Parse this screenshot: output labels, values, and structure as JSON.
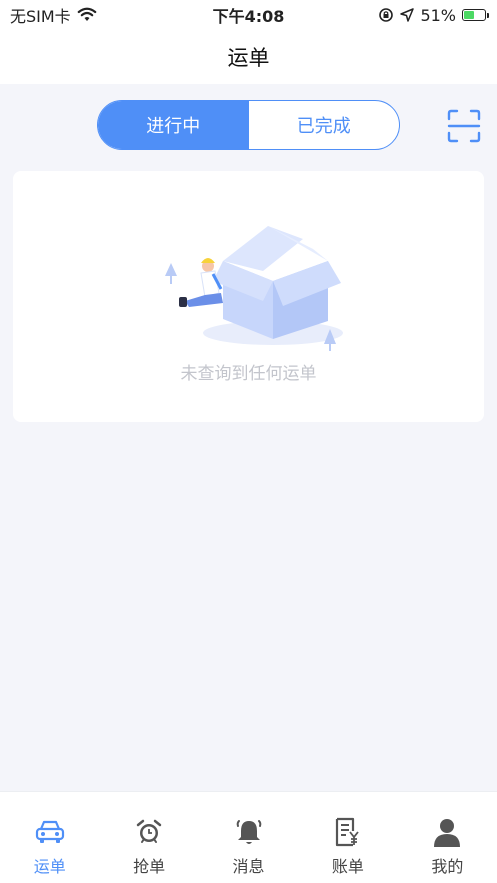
{
  "status_bar": {
    "carrier": "无SIM卡",
    "time": "下午4:08",
    "battery": "51%",
    "battery_level": 0.51
  },
  "nav": {
    "title": "运单"
  },
  "segment": {
    "tabs": [
      {
        "label": "进行中",
        "active": true
      },
      {
        "label": "已完成",
        "active": false
      }
    ]
  },
  "empty": {
    "message": "未查询到任何运单"
  },
  "tab_bar": {
    "items": [
      {
        "label": "运单",
        "icon": "car-icon",
        "active": true
      },
      {
        "label": "抢单",
        "icon": "alarm-clock-icon",
        "active": false
      },
      {
        "label": "消息",
        "icon": "bell-icon",
        "active": false
      },
      {
        "label": "账单",
        "icon": "bill-icon",
        "active": false
      },
      {
        "label": "我的",
        "icon": "user-icon",
        "active": false
      }
    ]
  },
  "colors": {
    "accent": "#4f8ff7",
    "background": "#f4f5fa",
    "inactive_icon": "#555555"
  }
}
